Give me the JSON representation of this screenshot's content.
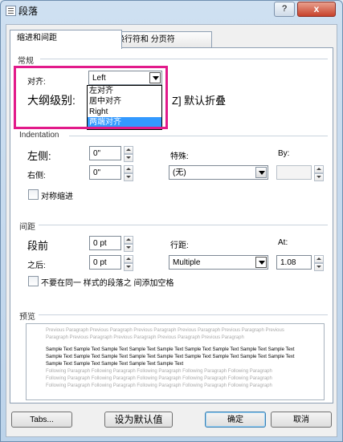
{
  "window": {
    "title": "段落",
    "help_label": "?",
    "close_label": "x"
  },
  "tabs": [
    {
      "label": "缩进和间距",
      "active": true
    },
    {
      "label": "换行符和 分页符",
      "active": false
    }
  ],
  "general": {
    "section_label": "常规",
    "alignment_label": "对齐:",
    "alignment_value": "Left",
    "alignment_options": [
      "左对齐",
      "居中对齐",
      "Right",
      "两端对齐"
    ],
    "selected_option_index": 3,
    "outline_label": "大纲级别:",
    "collapsed_label": "Z] 默认折叠"
  },
  "indentation": {
    "section_label": "Indentation",
    "left_label": "左侧:",
    "left_value": "0\"",
    "right_label": "右侧:",
    "right_value": "0\"",
    "special_label": "特殊:",
    "special_value": "(无)",
    "by_label": "By:",
    "by_value": "",
    "mirror_label": "对称缩进"
  },
  "spacing": {
    "section_label": "间距",
    "before_label": "段前",
    "before_value": "0 pt",
    "after_label": "之后:",
    "after_value": "0 pt",
    "line_spacing_label": "行距:",
    "line_spacing_value": "Multiple",
    "at_label": "At:",
    "at_value": "1.08",
    "no_space_label": "不要在同一 样式的段落之 间添加空格"
  },
  "preview": {
    "section_label": "预览",
    "previous_lines": [
      "Previous Paragraph Previous Paragraph Previous Paragraph Previous Paragraph Previous Paragraph Previous",
      "Paragraph Previous Paragraph Previous Paragraph Previous Paragraph Previous Paragraph"
    ],
    "sample_lines": [
      "Sample Text Sample Text Sample Text Sample Text Sample Text Sample Text Sample Text Sample Text Sample Text",
      "Sample Text Sample Text Sample Text Sample Text Sample Text Sample Text Sample Text Sample Text Sample Text",
      "Sample Text Sample Text Sample Text Sample Text Sample Text"
    ],
    "following_lines": [
      "Following Paragraph Following Paragraph Following Paragraph Following Paragraph Following Paragraph",
      "Following Paragraph Following Paragraph Following Paragraph Following Paragraph Following Paragraph",
      "Following Paragraph Following Paragraph Following Paragraph Following Paragraph Following Paragraph"
    ]
  },
  "buttons": {
    "tabs": "Tabs...",
    "set_default": "设为默认值",
    "ok": "确定",
    "cancel": "取消"
  },
  "colors": {
    "highlight": "#e21a8a",
    "selection": "#3399ff"
  }
}
